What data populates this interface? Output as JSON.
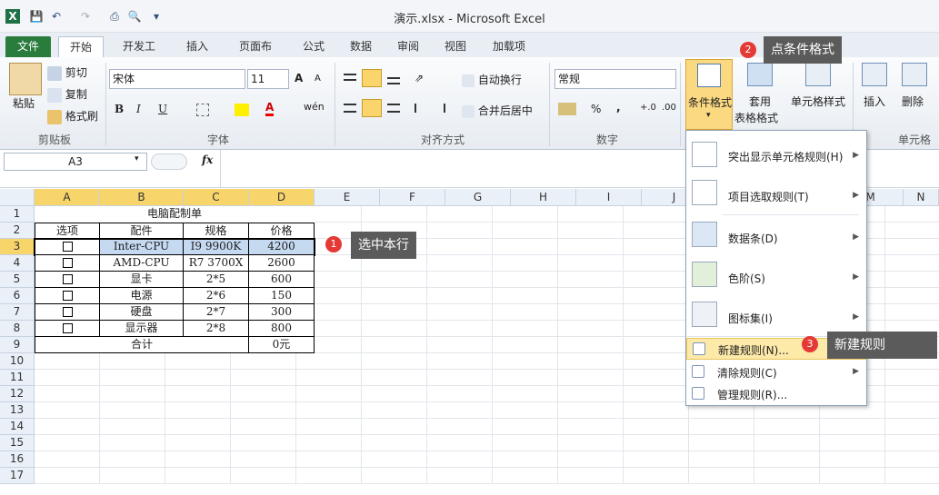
{
  "window": {
    "title": "演示.xlsx - Microsoft Excel"
  },
  "quick_access": [
    "excel-app-icon",
    "save-icon",
    "undo-icon",
    "redo-icon",
    "print-icon",
    "print-preview-icon",
    "customize-qa-icon"
  ],
  "tabs": [
    {
      "label": "文件"
    },
    {
      "label": "开始"
    },
    {
      "label": "开发工具"
    },
    {
      "label": "插入"
    },
    {
      "label": "页面布局"
    },
    {
      "label": "公式"
    },
    {
      "label": "数据"
    },
    {
      "label": "审阅"
    },
    {
      "label": "视图"
    },
    {
      "label": "加载项"
    }
  ],
  "ribbon": {
    "clipboard": {
      "paste": "粘贴",
      "cut": "剪切",
      "copy": "复制",
      "format_painter": "格式刷",
      "label": "剪贴板"
    },
    "font": {
      "name": "宋体",
      "size": "11",
      "bold": "B",
      "italic": "I",
      "underline": "U",
      "label": "字体",
      "wen": "wén",
      "grow": "A",
      "shrink": "A"
    },
    "alignment": {
      "wrap": "自动换行",
      "merge": "合并后居中",
      "label": "对齐方式"
    },
    "number": {
      "format": "常规",
      "percent": "%",
      "comma": ",",
      "label": "数字",
      "dec_inc": "+.0",
      "dec_dec": ".00"
    },
    "styles": {
      "conditional": "条件格式",
      "table": "套用",
      "table2": "表格格式",
      "cell_styles": "单元格样式"
    },
    "cells": {
      "insert": "插入",
      "delete": "删除",
      "label": "单元格"
    }
  },
  "formula_bar": {
    "name_box": "A3",
    "fx": "fx",
    "content": ""
  },
  "columns": [
    "A",
    "B",
    "C",
    "D",
    "E",
    "F",
    "G",
    "H",
    "I",
    "J",
    "K",
    "L",
    "M",
    "N"
  ],
  "rows": [
    "1",
    "2",
    "3",
    "4",
    "5",
    "6",
    "7",
    "8",
    "9",
    "10",
    "11",
    "12",
    "13",
    "14",
    "15",
    "16",
    "17"
  ],
  "sheet": {
    "title": "电脑配制单",
    "headers": [
      "选项",
      "配件",
      "规格",
      "价格"
    ],
    "items": [
      {
        "part": "Inter-CPU",
        "spec": "I9 9900K",
        "price": "4200"
      },
      {
        "part": "AMD-CPU",
        "spec": "R7 3700X",
        "price": "2600"
      },
      {
        "part": "显卡",
        "spec": "2*5",
        "price": "600"
      },
      {
        "part": "电源",
        "spec": "2*6",
        "price": "150"
      },
      {
        "part": "硬盘",
        "spec": "2*7",
        "price": "300"
      },
      {
        "part": "显示器",
        "spec": "2*8",
        "price": "800"
      }
    ],
    "total_label": "合计",
    "total_value": "0元"
  },
  "dropdown": {
    "items": [
      {
        "label": "突出显示单元格规则(H)"
      },
      {
        "label": "项目选取规则(T)"
      },
      {
        "label": "数据条(D)"
      },
      {
        "label": "色阶(S)"
      },
      {
        "label": "图标集(I)"
      },
      {
        "label": "新建规则(N)..."
      },
      {
        "label": "清除规则(C)"
      },
      {
        "label": "管理规则(R)..."
      }
    ]
  },
  "callouts": [
    {
      "num": "1",
      "text": "选中本行"
    },
    {
      "num": "2",
      "text": "点条件格式"
    },
    {
      "num": "3",
      "text": "新建规则"
    }
  ]
}
